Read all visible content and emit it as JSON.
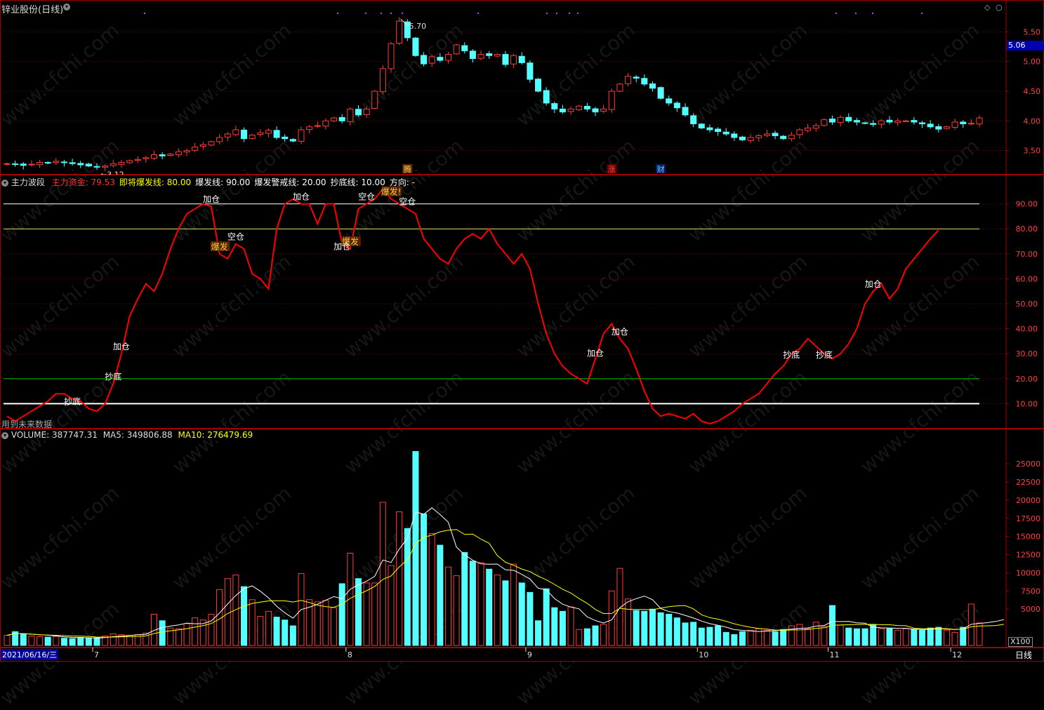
{
  "title": "锌业股份(日线)",
  "price_axis": {
    "ticks": [
      "5.50",
      "5.00",
      "4.50",
      "4.00",
      "3.50"
    ],
    "current_value": "5.06"
  },
  "price_annotations": {
    "high": "5.70",
    "low": "←3.12"
  },
  "event_tags": [
    "腾",
    "涨",
    "财"
  ],
  "indicator": {
    "name": "主力波段",
    "fields": [
      {
        "label": "主力资金:",
        "value": "79.53",
        "color": "#ff3030"
      },
      {
        "label": "即将爆发线:",
        "value": "80.00",
        "color": "#ffff00"
      },
      {
        "label": "爆发线:",
        "value": "90.00",
        "color": "#ffffff"
      },
      {
        "label": "爆发警戒线:",
        "value": "20.00",
        "color": "#ffffff"
      },
      {
        "label": "抄底线:",
        "value": "10.00",
        "color": "#ffffff"
      },
      {
        "label": "方向:",
        "value": "-",
        "color": "#ffffff"
      }
    ],
    "ticks": [
      "90.00",
      "80.00",
      "70.00",
      "60.00",
      "50.00",
      "40.00",
      "30.00",
      "20.00",
      "10.00"
    ],
    "footnote": "用到未来数据",
    "signals": [
      "抄底",
      "抄底",
      "加仓",
      "加仓",
      "爆发",
      "空仓",
      "加仓",
      "爆发",
      "空仓",
      "加仓",
      "爆发!",
      "空仓",
      "加仓",
      "加仓",
      "抄底",
      "抄底",
      "加仓"
    ]
  },
  "volume": {
    "label": "VOLUME:",
    "value": "387747.31",
    "ma5_label": "MA5:",
    "ma5": "349806.88",
    "ma10_label": "MA10:",
    "ma10": "276479.69",
    "ticks": [
      "25000",
      "22500",
      "20000",
      "17500",
      "15000",
      "12500",
      "10000",
      "7500",
      "5000"
    ],
    "unit": "X100"
  },
  "time_axis": {
    "start": "2021/06/16/三",
    "months": [
      "7",
      "8",
      "9",
      "10",
      "11",
      "12"
    ],
    "period": "日线"
  },
  "watermark": "www.cfchi.com",
  "colors": {
    "up": "#ff3c3c",
    "down": "#54ffff",
    "grid": "#7a0000",
    "line": "#ff0000",
    "ma10": "#ffff00",
    "ma5": "#ffffff",
    "green": "#00c000"
  },
  "chart_data": [
    {
      "type": "candlestick",
      "title": "锌业股份(日线)",
      "ylim": [
        3.2,
        5.8
      ],
      "close": [
        3.28,
        3.27,
        3.25,
        3.27,
        3.3,
        3.29,
        3.32,
        3.3,
        3.28,
        3.26,
        3.24,
        3.22,
        3.24,
        3.28,
        3.3,
        3.33,
        3.35,
        3.38,
        3.43,
        3.41,
        3.44,
        3.48,
        3.5,
        3.56,
        3.6,
        3.65,
        3.72,
        3.78,
        3.85,
        3.7,
        3.76,
        3.8,
        3.84,
        3.72,
        3.7,
        3.66,
        3.85,
        3.9,
        3.92,
        4.0,
        4.05,
        4.0,
        4.2,
        4.1,
        4.2,
        4.5,
        4.88,
        5.3,
        5.68,
        5.4,
        5.1,
        4.96,
        5.08,
        5.02,
        5.12,
        5.28,
        5.18,
        5.05,
        5.12,
        5.1,
        5.12,
        4.95,
        5.1,
        4.98,
        4.7,
        4.5,
        4.3,
        4.2,
        4.15,
        4.2,
        4.25,
        4.2,
        4.15,
        4.2,
        4.5,
        4.62,
        4.75,
        4.72,
        4.62,
        4.55,
        4.38,
        4.3,
        4.22,
        4.1,
        3.95,
        3.88,
        3.85,
        3.82,
        3.78,
        3.72,
        3.68,
        3.72,
        3.75,
        3.78,
        3.75,
        3.7,
        3.76,
        3.85,
        3.88,
        3.92,
        4.02,
        3.98,
        4.06,
        4.0,
        3.98,
        3.96,
        3.94,
        4.0,
        3.98,
        4.0,
        4.0,
        3.98,
        3.95,
        3.9,
        3.86,
        3.9,
        3.98,
        3.95,
        3.96,
        4.05
      ]
    },
    {
      "type": "line",
      "title": "主力波段",
      "ylim": [
        0,
        100
      ],
      "series": [
        {
          "name": "主力资金",
          "values": [
            5,
            3,
            5,
            7,
            9,
            11,
            14,
            14,
            12,
            11,
            8,
            7,
            10,
            18,
            30,
            45,
            52,
            58,
            55,
            62,
            72,
            80,
            86,
            88,
            90,
            89,
            70,
            68,
            74,
            72,
            62,
            60,
            56,
            80,
            90,
            92,
            90,
            90,
            82,
            90,
            90,
            74,
            72,
            88,
            90,
            92,
            96,
            92,
            90,
            88,
            86,
            76,
            72,
            68,
            66,
            72,
            76,
            78,
            76,
            80,
            74,
            70,
            66,
            70,
            64,
            50,
            38,
            30,
            25,
            22,
            20,
            18,
            28,
            38,
            42,
            36,
            32,
            24,
            15,
            8,
            5,
            6,
            5,
            4,
            6,
            3,
            2,
            3,
            5,
            7,
            10,
            12,
            14,
            18,
            22,
            25,
            30,
            32,
            36,
            33,
            30,
            28,
            30,
            34,
            40,
            50,
            55,
            58,
            52,
            56,
            64,
            68,
            72,
            76,
            79.53
          ]
        }
      ]
    },
    {
      "type": "bar",
      "title": "VOLUME",
      "ylim": [
        0,
        28000
      ],
      "series": [
        {
          "name": "VOLUME",
          "values": [
            1400,
            1900,
            1600,
            1300,
            1200,
            1150,
            1250,
            1000,
            950,
            1100,
            1000,
            1050,
            1300,
            1600,
            1500,
            1400,
            1500,
            1700,
            4300,
            3400,
            2400,
            2300,
            3000,
            3800,
            3500,
            4300,
            7700,
            9200,
            9700,
            8100,
            6300,
            4000,
            4700,
            3900,
            3500,
            2700,
            9900,
            6300,
            6000,
            6200,
            5200,
            8500,
            12700,
            9200,
            8600,
            8600,
            19700,
            11000,
            18400,
            16100,
            26700,
            18100,
            15400,
            13800,
            10800,
            9600,
            12800,
            11600,
            11400,
            10500,
            9700,
            8900,
            11200,
            8600,
            7300,
            3400,
            7800,
            5200,
            4700,
            5300,
            2200,
            2300,
            2700,
            2900,
            7500,
            10600,
            6400,
            4800,
            4700,
            5000,
            4500,
            4300,
            3800,
            3100,
            3200,
            2400,
            2500,
            2700,
            1800,
            1500,
            1900,
            2100,
            2300,
            2100,
            1900,
            2200,
            2700,
            2900,
            2300,
            3200,
            2600,
            5500,
            2800,
            2400,
            2300,
            2300,
            2800,
            2300,
            2300,
            2100,
            2300,
            2200,
            2100,
            2400,
            2500,
            2100,
            1800,
            2500,
            5700,
            3100,
            2600,
            2600,
            3800
          ]
        },
        {
          "name": "MA5"
        },
        {
          "name": "MA10"
        }
      ]
    }
  ]
}
